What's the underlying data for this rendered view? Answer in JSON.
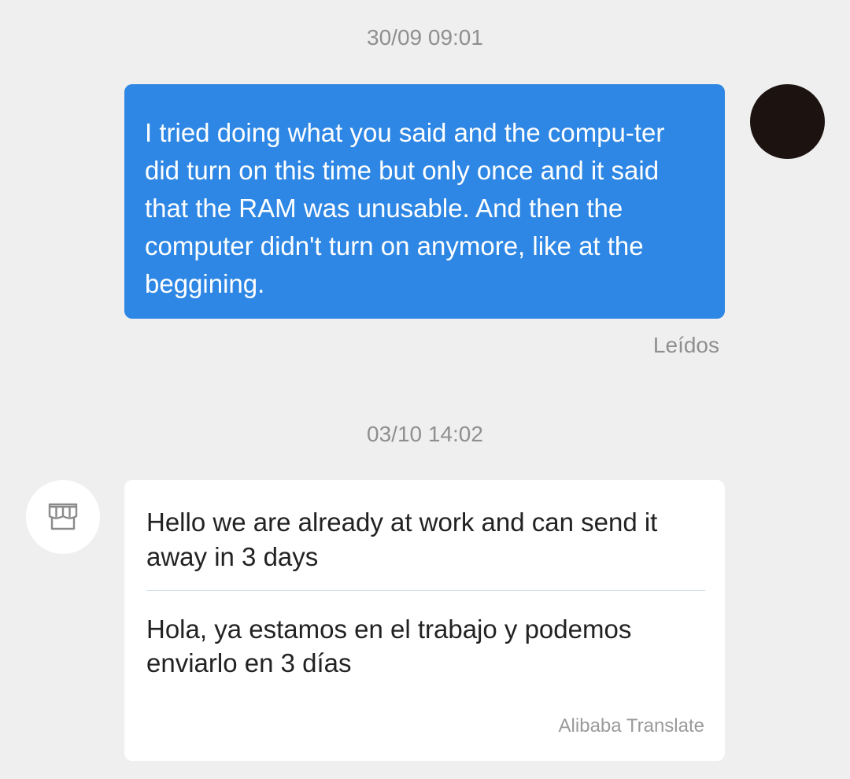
{
  "conversation": {
    "messages": [
      {
        "timestamp": "30/09 09:01",
        "direction": "outgoing",
        "text": "I tried doing what you said and the compu-ter did turn on this time but only once and it said that the RAM was unusable. And then the computer didn't turn on anymore, like at the beggining.",
        "status": "Leídos"
      },
      {
        "timestamp": "03/10 14:02",
        "direction": "incoming",
        "text": "Hello we are already at work and can send it away in 3 days",
        "translation": "Hola, ya estamos en el trabajo y podemos enviarlo en 3 días",
        "translation_credit": "Alibaba Translate"
      }
    ]
  },
  "avatars": {
    "user_color": "#1c1210",
    "shop_icon": "storefront-icon"
  },
  "colors": {
    "background": "#efefef",
    "outgoing_bubble": "#2e87e4",
    "incoming_bubble": "#ffffff",
    "meta_text": "#8f8f8f"
  }
}
